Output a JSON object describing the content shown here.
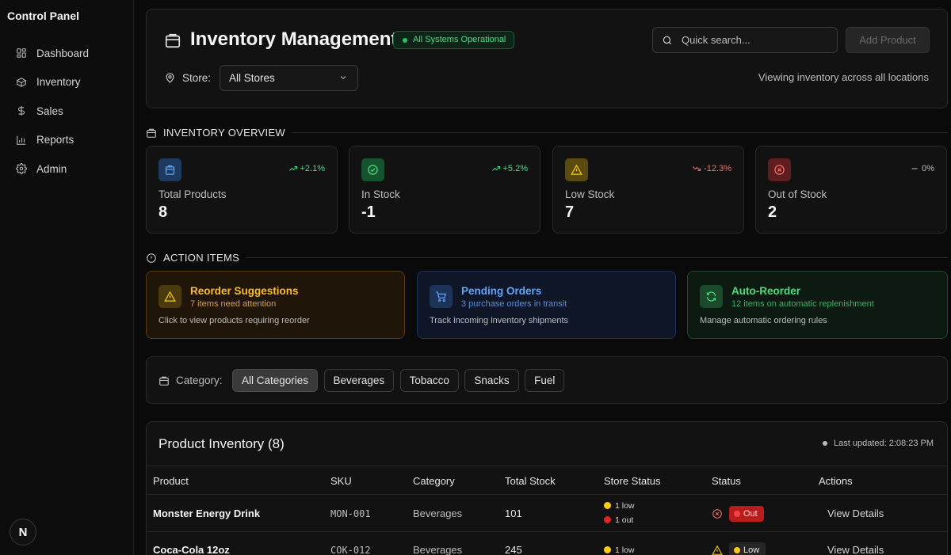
{
  "sidebar": {
    "brand": "Control Panel",
    "items": [
      {
        "label": "Dashboard",
        "icon": "dashboard-icon"
      },
      {
        "label": "Inventory",
        "icon": "box-icon"
      },
      {
        "label": "Sales",
        "icon": "dollar-icon"
      },
      {
        "label": "Reports",
        "icon": "bar-chart-icon"
      },
      {
        "label": "Admin",
        "icon": "gear-icon"
      }
    ],
    "avatar": "N"
  },
  "header": {
    "title": "Inventory Management",
    "status_badge": "All Systems Operational",
    "search_placeholder": "Quick search...",
    "add_button": "Add Product",
    "store_label": "Store:",
    "store_value": "All Stores",
    "viewing_text": "Viewing inventory across all locations"
  },
  "overview": {
    "heading": "INVENTORY OVERVIEW",
    "stats": [
      {
        "label": "Total Products",
        "value": "8",
        "trend": "+2.1%",
        "color": "#60a5fa"
      },
      {
        "label": "In Stock",
        "value": "-1",
        "trend": "+5.2%",
        "color": "#4ade80"
      },
      {
        "label": "Low Stock",
        "value": "7",
        "trend": "-12.3%",
        "color": "#facc15"
      },
      {
        "label": "Out of Stock",
        "value": "2",
        "trend": "0%",
        "color": "#f87171"
      }
    ]
  },
  "actions": {
    "heading": "ACTION ITEMS",
    "items": [
      {
        "title": "Reorder Suggestions",
        "subtitle": "7 items need attention",
        "desc": "Click to view products requiring reorder"
      },
      {
        "title": "Pending Orders",
        "subtitle": "3 purchase orders in transit",
        "desc": "Track incoming inventory shipments"
      },
      {
        "title": "Auto-Reorder",
        "subtitle": "12 items on automatic replenishment",
        "desc": "Manage automatic ordering rules"
      }
    ]
  },
  "category": {
    "label": "Category:",
    "chips": [
      "All Categories",
      "Beverages",
      "Tobacco",
      "Snacks",
      "Fuel"
    ],
    "active": "All Categories"
  },
  "table": {
    "title": "Product Inventory (8)",
    "updated": "Last updated: 2:08:23 PM",
    "headers": [
      "Product",
      "SKU",
      "Category",
      "Total Stock",
      "Store Status",
      "Status",
      "Actions"
    ],
    "rows": [
      {
        "product": "Monster Energy Drink",
        "sku": "MON-001",
        "category": "Beverages",
        "stock": "101",
        "store_status": [
          "1 low",
          "1 out"
        ],
        "status": "Out",
        "action": "View Details"
      },
      {
        "product": "Coca-Cola 12oz",
        "sku": "COK-012",
        "category": "Beverages",
        "stock": "245",
        "store_status": [
          "1 low"
        ],
        "status": "Low",
        "action": "View Details"
      }
    ]
  }
}
